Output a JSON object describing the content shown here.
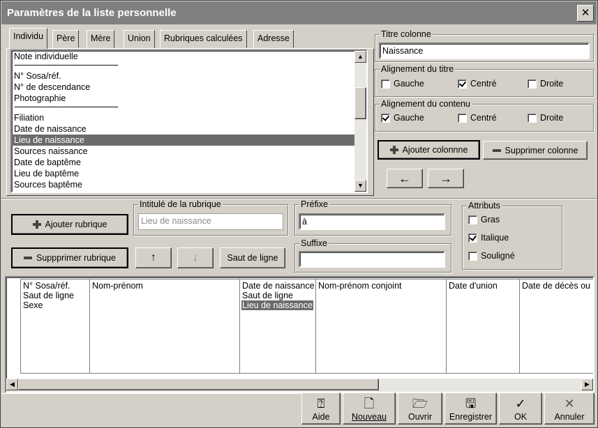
{
  "window": {
    "title": "Paramètres de la liste personnelle",
    "close_glyph": "✕"
  },
  "tabs": [
    "Individu",
    "Père",
    "Mère",
    "Union",
    "Rubriques calculées",
    "Adresse"
  ],
  "field_list": {
    "items": [
      {
        "text": "Note individuelle",
        "kind": "item"
      },
      {
        "text": "-----------------------------------------------",
        "kind": "sep"
      },
      {
        "text": "N° Sosa/réf.",
        "kind": "item"
      },
      {
        "text": "N° de descendance",
        "kind": "item"
      },
      {
        "text": "Photographie",
        "kind": "item"
      },
      {
        "text": "-----------------------------------------------",
        "kind": "sep"
      },
      {
        "text": "Filiation",
        "kind": "item"
      },
      {
        "text": "Date de naissance",
        "kind": "item"
      },
      {
        "text": "Lieu de naissance",
        "kind": "selected"
      },
      {
        "text": "Sources naissance",
        "kind": "item"
      },
      {
        "text": "Date de baptême",
        "kind": "item"
      },
      {
        "text": "Lieu de baptême",
        "kind": "item"
      },
      {
        "text": "Sources baptême",
        "kind": "item"
      }
    ]
  },
  "column_title": {
    "label": "Titre colonne",
    "value": "Naissance"
  },
  "title_align": {
    "label": "Alignement du titre",
    "left": "Gauche",
    "center": "Centré",
    "right": "Droite",
    "checked": "center"
  },
  "content_align": {
    "label": "Alignement du contenu",
    "left": "Gauche",
    "center": "Centré",
    "right": "Droite",
    "checked": "left"
  },
  "column_buttons": {
    "add": "Ajouter colonnne",
    "remove": "Supprimer colonne",
    "left_arrow": "←",
    "right_arrow": "→"
  },
  "rubrique": {
    "add": "Ajouter rubrique",
    "remove": "Suppprimer rubrique",
    "up": "↑",
    "down": "↓",
    "line_break": "Saut de ligne",
    "heading_label": "Intitulé de la rubrique",
    "heading_value": "Lieu de naissance",
    "prefix_label": "Préfixe",
    "prefix_value": "à",
    "suffix_label": "Suffixe",
    "suffix_value": ""
  },
  "attributes": {
    "label": "Attributs",
    "bold": "Gras",
    "italic": "Italique",
    "underline": "Souligné",
    "italic_checked": true
  },
  "columns": [
    {
      "lines": [
        "N° Sosa/réf.",
        "Saut de ligne",
        "Sexe"
      ],
      "selected": -1
    },
    {
      "lines": [
        "Nom-prénom"
      ],
      "selected": -1
    },
    {
      "lines": [
        "Date de naissance",
        "Saut de ligne",
        "Lieu de naissance"
      ],
      "selected": 2
    },
    {
      "lines": [
        "Nom-prénom conjoint"
      ],
      "selected": -1
    },
    {
      "lines": [
        "Date d'union"
      ],
      "selected": -1
    },
    {
      "lines": [
        "Date de décès ou"
      ],
      "selected": -1
    }
  ],
  "toolbar": {
    "help": "Aide",
    "new": "Nouveau",
    "open": "Ouvrir",
    "save": "Enregistrer",
    "ok": "OK",
    "cancel": "Annuler"
  },
  "icons": {
    "help": "help-icon",
    "new": "new-document-icon",
    "open": "open-folder-icon",
    "save": "floppy-disk-icon",
    "ok": "checkmark-icon",
    "cancel": "cross-icon"
  }
}
